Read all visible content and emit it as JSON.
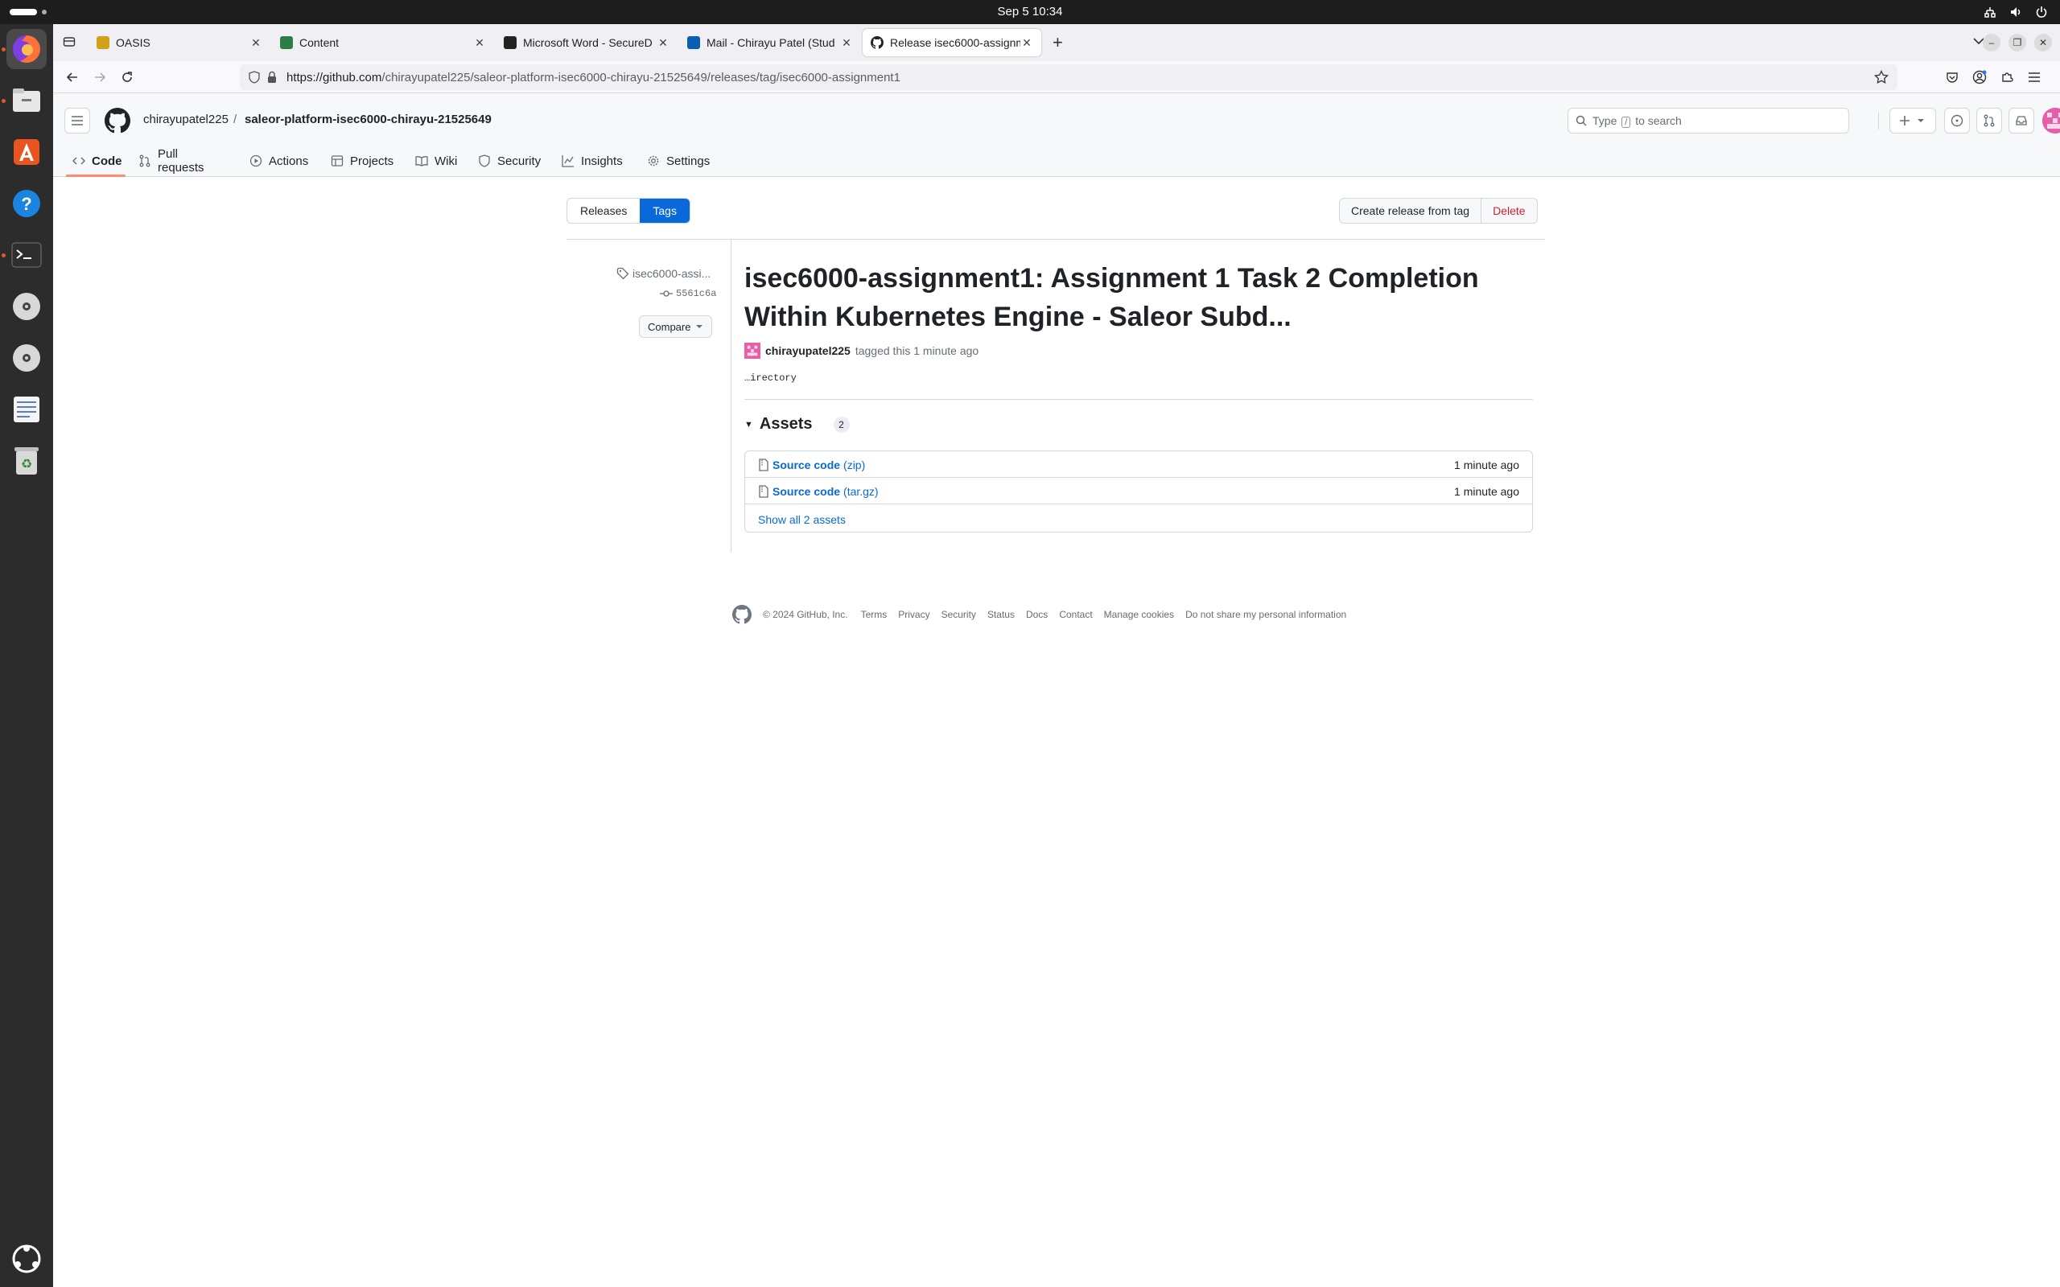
{
  "os": {
    "clock": "Sep 5  10:34"
  },
  "browser": {
    "tabs": [
      {
        "label": "OASIS",
        "favicon_color": "#d4a017"
      },
      {
        "label": "Content",
        "favicon_color": "#2d7d46"
      },
      {
        "label": "Microsoft Word - SecureD",
        "favicon_color": "#222222"
      },
      {
        "label": "Mail - Chirayu Patel (Stud",
        "favicon_color": "#0a5fb4"
      },
      {
        "label": "Release isec6000-assignm",
        "favicon_color": "#1f2328"
      }
    ],
    "url_host": "https://github.com",
    "url_path": "/chirayupatel225/saleor-platform-isec6000-chirayu-21525649/releases/tag/isec6000-assignment1"
  },
  "github": {
    "owner": "chirayupatel225",
    "separator": "/",
    "repo": "saleor-platform-isec6000-chirayu-21525649",
    "search_prefix": "Type",
    "search_key": "/",
    "search_suffix": "to search",
    "repo_tabs": [
      "Code",
      "Pull requests",
      "Actions",
      "Projects",
      "Wiki",
      "Security",
      "Insights",
      "Settings"
    ]
  },
  "release": {
    "segmented": {
      "releases": "Releases",
      "tags": "Tags"
    },
    "create_button": "Create release from tag",
    "delete_button": "Delete",
    "sidebar_tag": "isec6000-assi...",
    "sidebar_commit": "5561c6a",
    "compare_button": "Compare",
    "title": "isec6000-assignment1: Assignment 1 Task 2 Completion Within Kubernetes Engine - Saleor Subd...",
    "author": "chirayupatel225",
    "tagged_text": "tagged this 1 minute ago",
    "body": "…irectory",
    "assets_heading": "Assets",
    "assets_count": "2",
    "assets": [
      {
        "name": "Source code",
        "ext": "(zip)",
        "time": "1 minute ago"
      },
      {
        "name": "Source code",
        "ext": "(tar.gz)",
        "time": "1 minute ago"
      }
    ],
    "show_all": "Show all 2 assets"
  },
  "footer": {
    "copyright": "© 2024 GitHub, Inc.",
    "links": [
      "Terms",
      "Privacy",
      "Security",
      "Status",
      "Docs",
      "Contact",
      "Manage cookies",
      "Do not share my personal information"
    ]
  },
  "colors": {
    "accent": "#0969da",
    "danger": "#cf222e",
    "tab_underline": "#fd8c73"
  }
}
